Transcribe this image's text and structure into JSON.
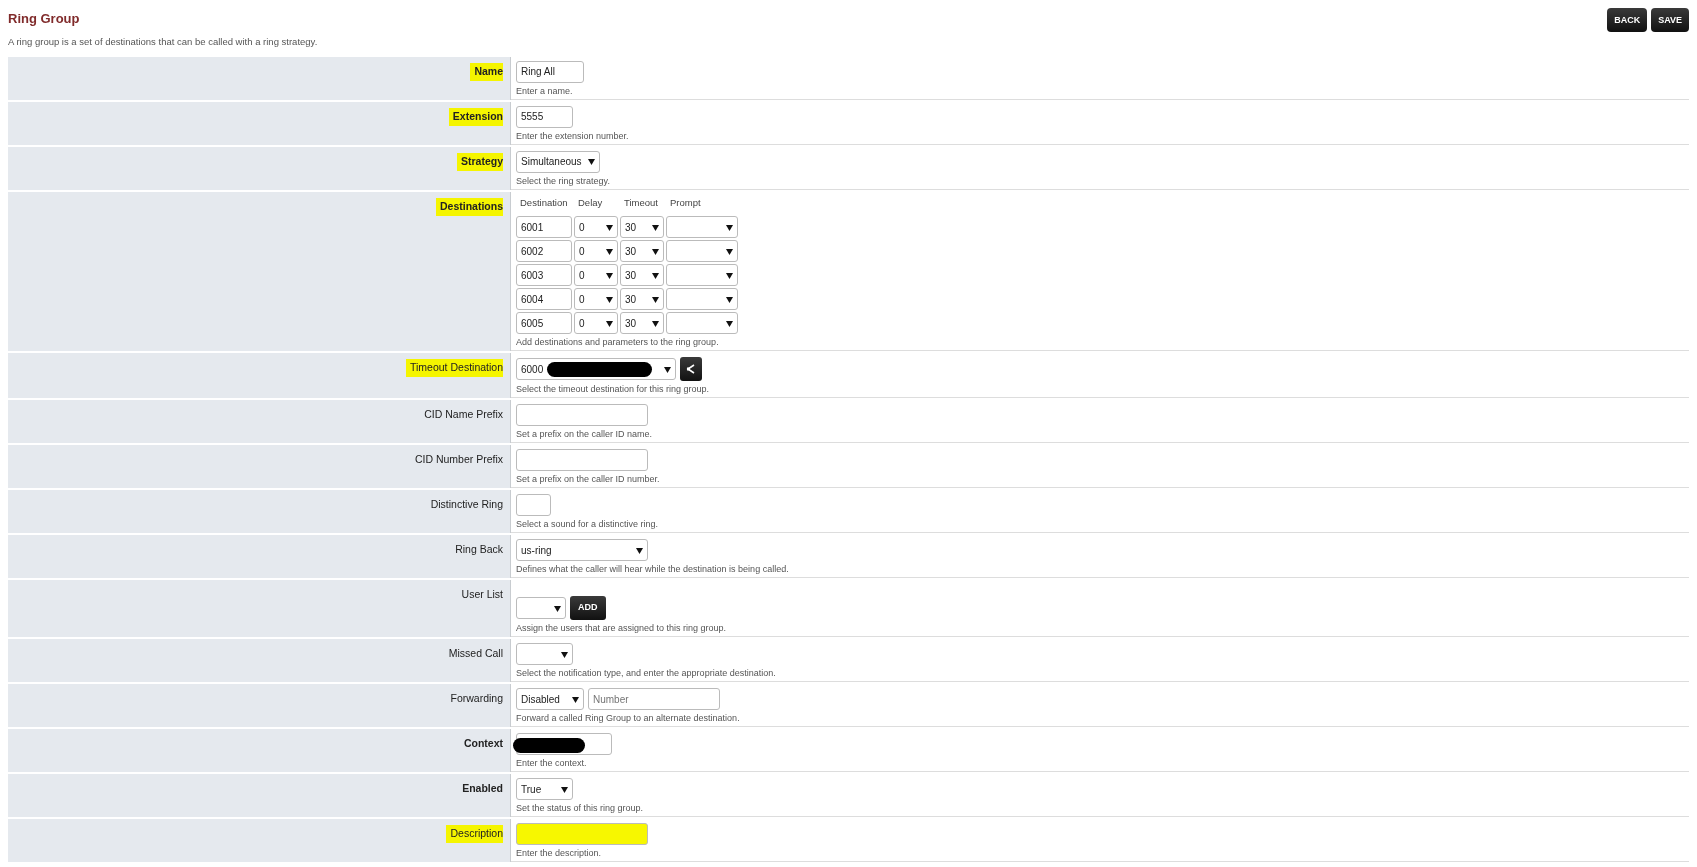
{
  "header": {
    "title": "Ring Group",
    "description": "A ring group is a set of destinations that can be called with a ring strategy.",
    "buttons": [
      "BACK",
      "SAVE"
    ]
  },
  "fields": [
    {
      "label": "Name",
      "kind": "text",
      "required": true,
      "highlighted": true,
      "value": "Ring All",
      "hint": "Enter a name."
    },
    {
      "label": "Extension",
      "kind": "text",
      "required": true,
      "highlighted": true,
      "value": "5555",
      "hint": "Enter the extension number."
    },
    {
      "label": "Strategy",
      "kind": "select",
      "required": true,
      "highlighted": true,
      "value": "Simultaneous",
      "hint": "Select the ring strategy."
    },
    {
      "label": "Destinations",
      "kind": "destinations",
      "required": true,
      "highlighted": true,
      "columns": [
        "Destination",
        "Delay",
        "Timeout",
        "Prompt"
      ],
      "rows": [
        {
          "destination": "6001",
          "delay": "0",
          "timeout": "30"
        },
        {
          "destination": "6002",
          "delay": "0",
          "timeout": "30"
        },
        {
          "destination": "6003",
          "delay": "0",
          "timeout": "30"
        },
        {
          "destination": "6004",
          "delay": "0",
          "timeout": "30"
        },
        {
          "destination": "6005",
          "delay": "0",
          "timeout": "30"
        }
      ],
      "hint": "Add destinations and parameters to the ring group."
    },
    {
      "label": "Timeout Destination",
      "kind": "select_button",
      "required": false,
      "highlighted": true,
      "value": "6000",
      "redacted": true,
      "hint": "Select the timeout destination for this ring group."
    },
    {
      "label": "CID Name Prefix",
      "kind": "text",
      "required": false,
      "highlighted": false,
      "hint": "Set a prefix on the caller ID name."
    },
    {
      "label": "CID Number Prefix",
      "kind": "text",
      "required": false,
      "highlighted": false,
      "hint": "Set a prefix on the caller ID number."
    },
    {
      "label": "Distinctive Ring",
      "kind": "text",
      "required": false,
      "highlighted": false,
      "hint": "Select a sound for a distinctive ring."
    },
    {
      "label": "Ring Back",
      "kind": "select",
      "required": false,
      "highlighted": false,
      "value": "us-ring",
      "hint": "Defines what the caller will hear while the destination is being called."
    },
    {
      "label": "User List",
      "kind": "select_add",
      "required": false,
      "highlighted": false,
      "button": "ADD",
      "hint": "Assign the users that are assigned to this ring group."
    },
    {
      "label": "Missed Call",
      "kind": "select",
      "required": false,
      "highlighted": false,
      "hint": "Select the notification type, and enter the appropriate destination."
    },
    {
      "label": "Forwarding",
      "kind": "forwarding",
      "required": false,
      "highlighted": false,
      "value": "Disabled",
      "placeholder": "Number",
      "hint": "Forward a called Ring Group to an alternate destination."
    },
    {
      "label": "Context",
      "kind": "text",
      "required": true,
      "highlighted": false,
      "redacted": true,
      "hint": "Enter the context."
    },
    {
      "label": "Enabled",
      "kind": "select",
      "required": true,
      "highlighted": false,
      "value": "True",
      "hint": "Set the status of this ring group."
    },
    {
      "label": "Description",
      "kind": "text",
      "required": false,
      "highlighted": true,
      "scribbled": true,
      "hint": "Enter the description."
    }
  ]
}
